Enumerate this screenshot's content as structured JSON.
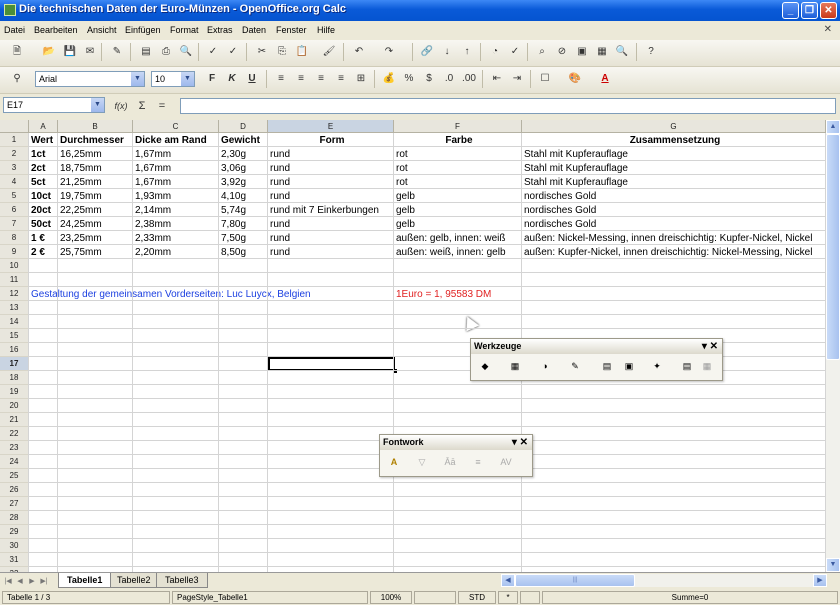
{
  "window": {
    "title": "Die technischen Daten der Euro-Münzen - OpenOffice.org Calc"
  },
  "menu": [
    "Datei",
    "Bearbeiten",
    "Ansicht",
    "Einfügen",
    "Format",
    "Extras",
    "Daten",
    "Fenster",
    "Hilfe"
  ],
  "format_bar": {
    "font_name": "Arial",
    "font_size": "10"
  },
  "formula_bar": {
    "cell_ref": "E17",
    "fx_label": "f(x)",
    "sum_label": "Σ",
    "equals_label": "=",
    "content": ""
  },
  "columns": [
    "A",
    "B",
    "C",
    "D",
    "E",
    "F",
    "G"
  ],
  "active_column": "E",
  "rows": [
    "1",
    "2",
    "3",
    "4",
    "5",
    "6",
    "7",
    "8",
    "9",
    "10",
    "11",
    "12",
    "13",
    "14",
    "15",
    "16",
    "17",
    "18",
    "19",
    "20",
    "21",
    "22",
    "23",
    "24",
    "25",
    "26",
    "27",
    "28",
    "29",
    "30",
    "31",
    "32"
  ],
  "active_row": "17",
  "table": {
    "headers": [
      "Wert",
      "Durchmesser",
      "Dicke am Rand",
      "Gewicht",
      "Form",
      "Farbe",
      "Zusammensetzung"
    ],
    "rows": [
      [
        "1ct",
        "16,25mm",
        "1,67mm",
        "2,30g",
        "rund",
        "rot",
        "Stahl mit Kupferauflage"
      ],
      [
        "2ct",
        "18,75mm",
        "1,67mm",
        "3,06g",
        "rund",
        "rot",
        "Stahl mit Kupferauflage"
      ],
      [
        "5ct",
        "21,25mm",
        "1,67mm",
        "3,92g",
        "rund",
        "rot",
        "Stahl mit Kupferauflage"
      ],
      [
        "10ct",
        "19,75mm",
        "1,93mm",
        "4,10g",
        "rund",
        "gelb",
        "nordisches Gold"
      ],
      [
        "20ct",
        "22,25mm",
        "2,14mm",
        "5,74g",
        "rund mit 7 Einkerbungen",
        "gelb",
        "nordisches Gold"
      ],
      [
        "50ct",
        "24,25mm",
        "2,38mm",
        "7,80g",
        "rund",
        "gelb",
        "nordisches Gold"
      ],
      [
        "1 €",
        "23,25mm",
        "2,33mm",
        "7,50g",
        "rund",
        "außen: gelb, innen: weiß",
        "außen: Nickel-Messing, innen dreischichtig: Kupfer-Nickel, Nickel"
      ],
      [
        "2 €",
        "25,75mm",
        "2,20mm",
        "8,50g",
        "rund",
        "außen: weiß, innen: gelb",
        "außen: Kupfer-Nickel, innen dreischichtig: Nickel-Messing, Nickel"
      ]
    ],
    "note_a12": "Gestaltung der gemeinsamen Vorderseiten: Luc Luycx, Belgien",
    "note_f12": "1Euro = 1, 95583 DM"
  },
  "toolbars": {
    "werkzeuge": "Werkzeuge",
    "fontwork": "Fontwork"
  },
  "sheet_tabs": [
    "Tabelle1",
    "Tabelle2",
    "Tabelle3"
  ],
  "status": {
    "sheet": "Tabelle 1 / 3",
    "style": "PageStyle_Tabelle1",
    "zoom": "100%",
    "mode": "STD",
    "modified": "*",
    "sum": "Summe=0"
  },
  "colors": {
    "blue_text": "#1b3fe0",
    "red_text": "#e02020",
    "title_bar": "#0a5ad8"
  }
}
